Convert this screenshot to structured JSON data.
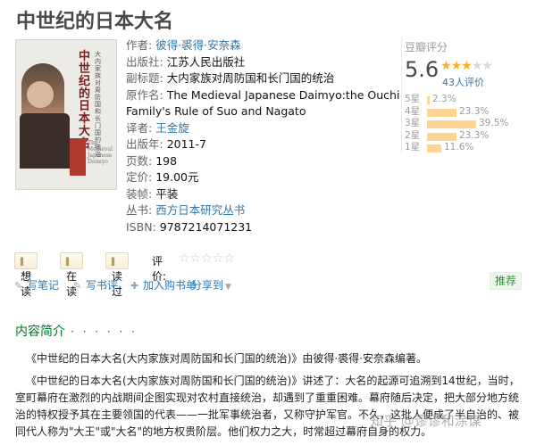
{
  "book": {
    "title": "中世纪的日本大名"
  },
  "cover": {
    "vertical_title": "中世纪的日本大名",
    "vertical_subtitle": "大内家族对周防国和长门国的统治",
    "english_text": "The Medieval Japanese Daimyo"
  },
  "info": {
    "author_label": "作者:",
    "author_value": "彼得·裘得·安奈森",
    "publisher_label": "出版社:",
    "publisher_value": "江苏人民出版社",
    "subtitle_label": "副标题:",
    "subtitle_value": "大内家族对周防国和长门国的统治",
    "original_label": "原作名:",
    "original_value_1": "The Medieval Japanese Daimyo:the Ouchi",
    "original_value_2": "Family's Rule of Suo and Nagato",
    "translator_label": "译者:",
    "translator_value": "王金旋",
    "pubdate_label": "出版年:",
    "pubdate_value": "2011-7",
    "pages_label": "页数:",
    "pages_value": "198",
    "price_label": "定价:",
    "price_value": "19.00元",
    "binding_label": "装帧:",
    "binding_value": "平装",
    "series_label": "丛书:",
    "series_value": "西方日本研究丛书",
    "isbn_label": "ISBN:",
    "isbn_value": "9787214071231"
  },
  "rating": {
    "heading": "豆瓣评分",
    "score": "5.6",
    "stars_filled": 3,
    "stars_total": 5,
    "count": "43人评价",
    "histogram": [
      {
        "label": "5星",
        "percent": 2.3,
        "text": "2.3%"
      },
      {
        "label": "4星",
        "percent": 23.3,
        "text": "23.3%"
      },
      {
        "label": "3星",
        "percent": 39.5,
        "text": "39.5%"
      },
      {
        "label": "2星",
        "percent": 23.3,
        "text": "23.3%"
      },
      {
        "label": "1星",
        "percent": 11.6,
        "text": "11.6%"
      }
    ],
    "bar_color": "#ffd596",
    "star_color": "#ffac2d"
  },
  "actions": {
    "want_read": "想读",
    "reading": "在读",
    "read": "读过",
    "rate_label": "评价:",
    "rate_stars": "☆☆☆☆☆"
  },
  "tools": {
    "note": "写笔记",
    "review": "写书评",
    "cart": "加入购书单",
    "share": "分享到",
    "recommend": "推荐"
  },
  "section": {
    "heading": "内容简介",
    "dots": "· · · · · ·"
  },
  "intro": {
    "p1": "《中世纪的日本大名(大内家族对周防国和长门国的统治)》由彼得·裘得·安奈森编著。",
    "p2": "《中世纪的日本大名(大内家族对周防国和长门国的统治)》讲述了：大名的起源可追溯到14世纪，当时，室町幕府在激烈的内战期间企图实现对农村直接统治，却遇到了重重困难。幕府随后决定，把大部分地方统治的特权授予其在主要领国的代表——一批军事统治者，又称守护军官。不久，这批人便成了半自治的、被同代人称为\"大王\"或\"大名\"的地方权贵阶层。他们权力之大，时常超过幕府自身的权力。"
  },
  "watermark": "知乎 @谬谬和涂谋",
  "colors": {
    "link": "#3377aa",
    "section": "#007722",
    "title": "#494949"
  }
}
